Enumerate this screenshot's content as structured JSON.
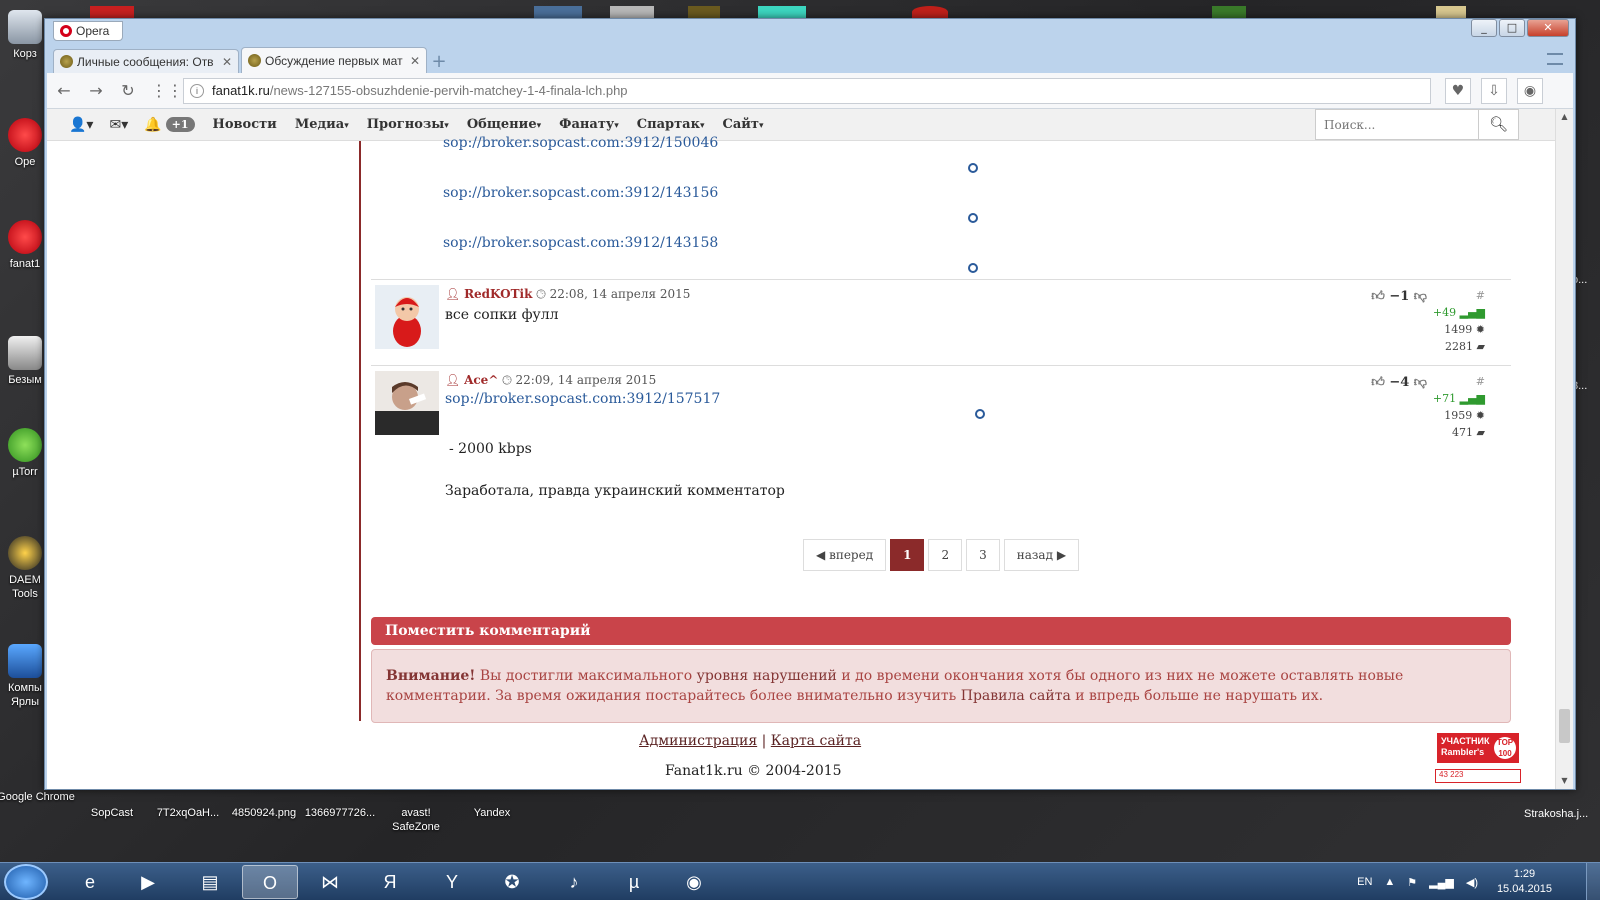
{
  "desktop": {
    "left_icons": [
      {
        "label": "Корз"
      },
      {
        "label": "Ope"
      },
      {
        "label": "fanat1"
      },
      {
        "label": "Безым"
      },
      {
        "label": "µTorr"
      },
      {
        "label": "DAEM Tools"
      },
      {
        "label": "Компы Ярлы"
      }
    ],
    "bottom_icons": [
      {
        "label": "Google Chrome"
      },
      {
        "label": "SopCast"
      },
      {
        "label": "7T2xqOaH..."
      },
      {
        "label": "4850924.png"
      },
      {
        "label": "1366977726..."
      },
      {
        "label": "avast! SafeZone"
      },
      {
        "label": "Yandex"
      }
    ],
    "right_texts": [
      "o...",
      "8..."
    ],
    "right_file": "Strakosha.j..."
  },
  "browser": {
    "app_name": "Opera",
    "tabs": [
      {
        "title": "Личные сообщения: Отв",
        "close": "✕"
      },
      {
        "title": "Обсуждение первых мат",
        "close": "✕"
      }
    ],
    "url_domain": "fanat1k.ru",
    "url_path": "/news-127155-obsuzhdenie-pervih-matchey-1-4-finala-lch.php"
  },
  "site": {
    "badge": "+1",
    "nav": [
      {
        "label": "Новости",
        "caret": ""
      },
      {
        "label": "Медиа",
        "caret": "▾"
      },
      {
        "label": "Прогнозы",
        "caret": "▾"
      },
      {
        "label": "Общение",
        "caret": "▾"
      },
      {
        "label": "Фанату",
        "caret": "▾"
      },
      {
        "label": "Спартак",
        "caret": "▾"
      },
      {
        "label": "Сайт",
        "caret": "▾"
      }
    ],
    "search_placeholder": "Поиск..."
  },
  "prev_links": [
    "sop://broker.sopcast.com:3912/150046",
    "sop://broker.sopcast.com:3912/143156",
    "sop://broker.sopcast.com:3912/143158"
  ],
  "comments": [
    {
      "user": "RedKOTik",
      "time": "22:08, 14 апреля 2015",
      "text": "все сопки фулл",
      "votes": "−1",
      "hash": "#",
      "rating": "+49",
      "points": "1499",
      "count": "2281"
    },
    {
      "user": "Ace^",
      "time": "22:09, 14 апреля 2015",
      "link": "sop://broker.sopcast.com:3912/157517",
      "line2": "- 2000 kbps",
      "line3": "Заработала, правда украинский комментатор",
      "votes": "−4",
      "hash": "#",
      "rating": "+71",
      "points": "1959",
      "count": "471"
    }
  ],
  "pagination": {
    "prev": "вперед",
    "pages": [
      "1",
      "2",
      "3"
    ],
    "next": "назад"
  },
  "post_comment": {
    "header": "Поместить комментарий",
    "alert_title": "Внимание!",
    "alert_t1": " Вы достигли максимального ",
    "alert_link1": "уровня нарушений",
    "alert_t2": " и до времени окончания хотя бы одного из них не можете оставлять новые комментарии. За время ожидания постарайтесь более внимательно изучить ",
    "alert_link2": "Правила сайта",
    "alert_t3": " и впредь больше не нарушать их."
  },
  "footer": {
    "admin": "Администрация",
    "sep": " | ",
    "sitemap": "Карта сайта",
    "copyright": "Fanat1k.ru © 2004-2015",
    "rambler_line1": "УЧАСТНИК",
    "rambler_line2": "Rambler's",
    "rambler_top": "TOP 100",
    "rambler_count": "43 223"
  },
  "taskbar": {
    "lang": "EN",
    "time": "1:29",
    "date": "15.04.2015"
  }
}
